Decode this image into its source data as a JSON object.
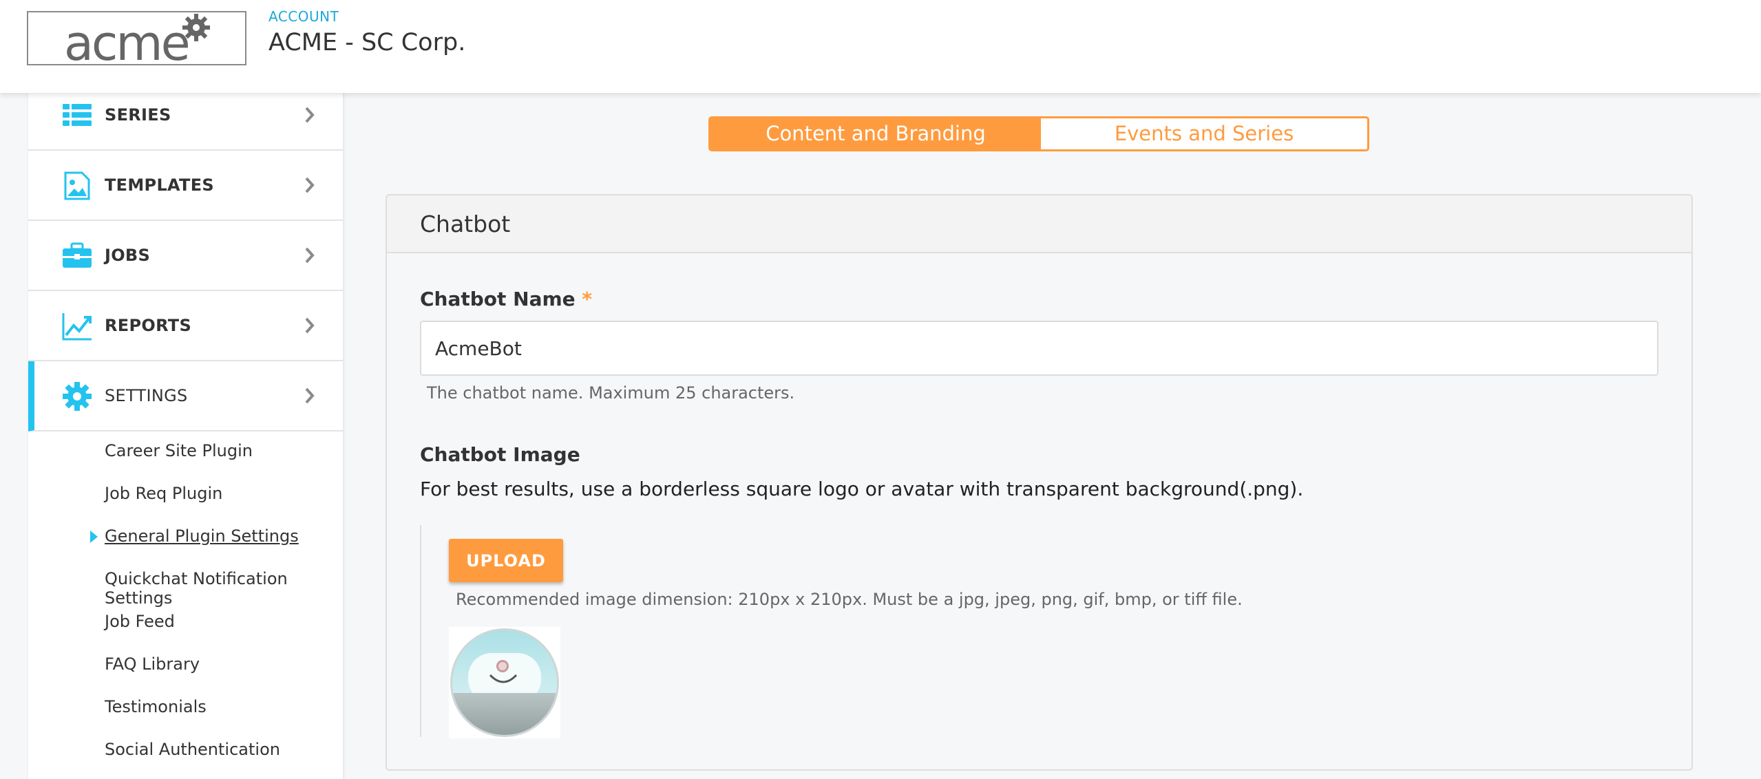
{
  "header": {
    "logo_text": "acme",
    "account_label": "ACCOUNT",
    "account_name": "ACME - SC Corp."
  },
  "sidebar": {
    "items": [
      {
        "label": "SERIES",
        "icon": "list-icon"
      },
      {
        "label": "TEMPLATES",
        "icon": "image-icon"
      },
      {
        "label": "JOBS",
        "icon": "briefcase-icon"
      },
      {
        "label": "REPORTS",
        "icon": "chart-line-icon"
      },
      {
        "label": "SETTINGS",
        "icon": "gear-icon",
        "active": true
      }
    ],
    "subitems": [
      {
        "label": "Career Site Plugin"
      },
      {
        "label": "Job Req Plugin"
      },
      {
        "label": "General Plugin Settings",
        "active": true
      },
      {
        "label": "Quickchat Notification Settings"
      },
      {
        "label": "Job Feed"
      },
      {
        "label": "FAQ Library"
      },
      {
        "label": "Testimonials"
      },
      {
        "label": "Social Authentication"
      }
    ]
  },
  "tabs": [
    {
      "label": "Content and Branding",
      "active": true
    },
    {
      "label": "Events and Series",
      "active": false
    }
  ],
  "panel": {
    "title": "Chatbot",
    "name_label": "Chatbot Name",
    "required_mark": "*",
    "name_value": "AcmeBot",
    "name_help": "The chatbot name. Maximum 25 characters.",
    "image_label": "Chatbot Image",
    "image_desc": "For best results, use a borderless square logo or avatar with transparent background(.png).",
    "upload_label": "UPLOAD",
    "image_help": "Recommended image dimension: 210px x 210px. Must be a jpg, jpeg, png, gif, bmp, or tiff file."
  },
  "colors": {
    "accent": "#ff9b3f",
    "nav_icon": "#24c3ef",
    "account_label": "#1ba9d9"
  }
}
